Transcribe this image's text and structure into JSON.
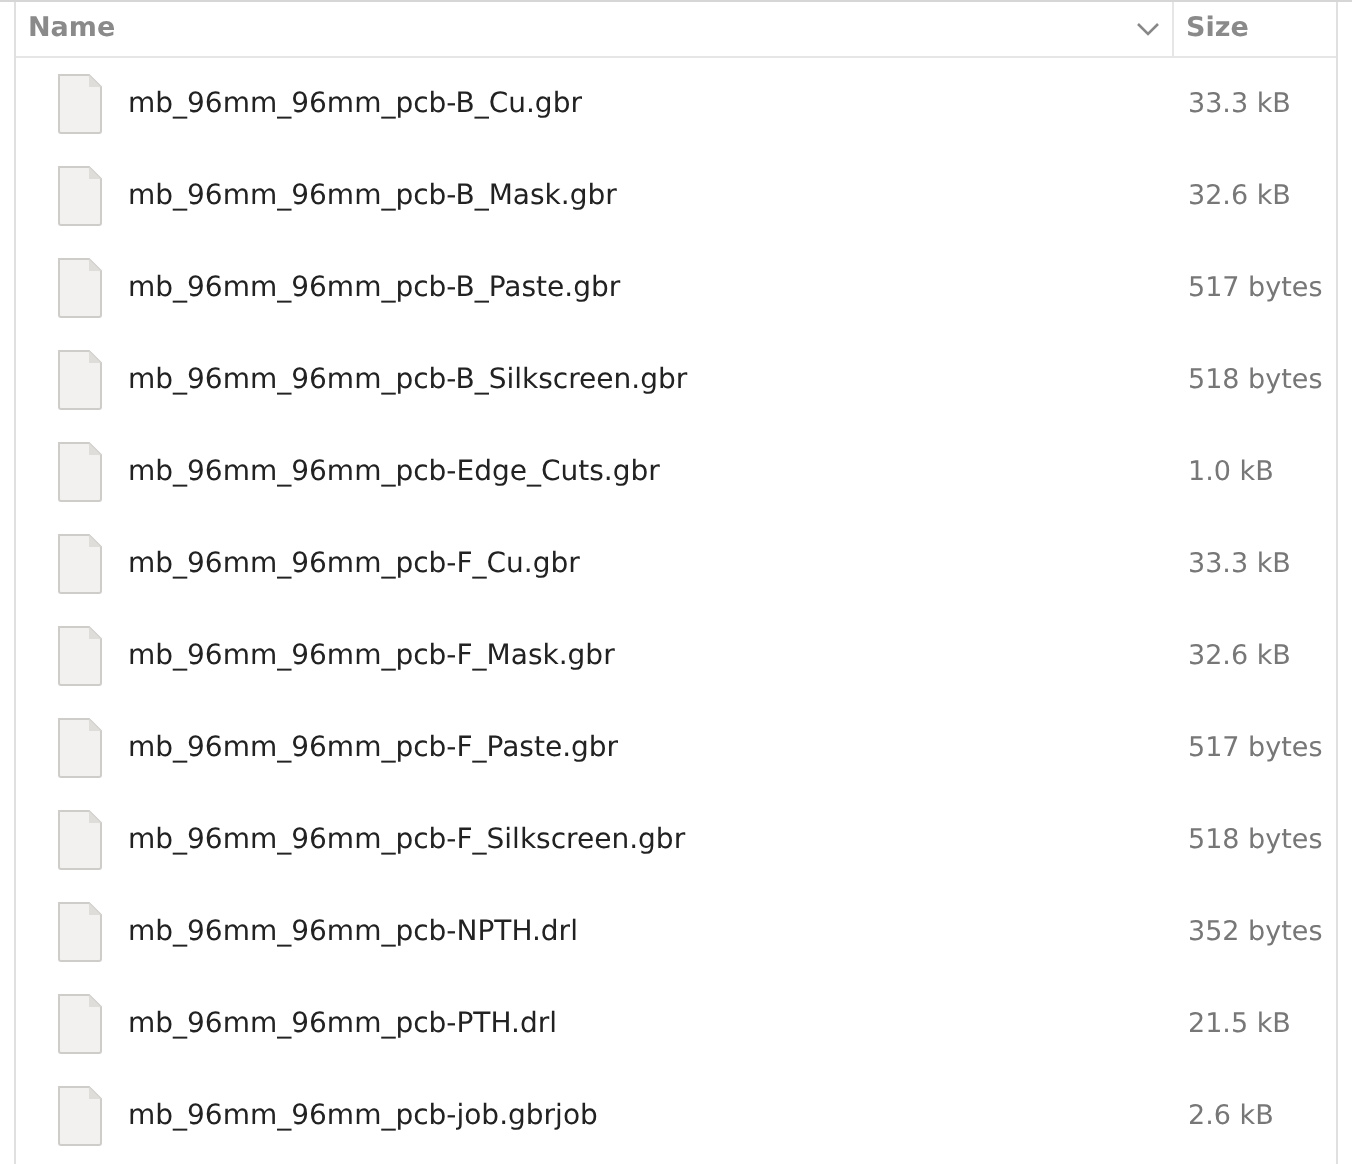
{
  "columns": [
    {
      "label": "Name",
      "sorted": true
    },
    {
      "label": "Size",
      "sorted": false
    }
  ],
  "files": [
    {
      "name": "mb_96mm_96mm_pcb-B_Cu.gbr",
      "size": "33.3 kB"
    },
    {
      "name": "mb_96mm_96mm_pcb-B_Mask.gbr",
      "size": "32.6 kB"
    },
    {
      "name": "mb_96mm_96mm_pcb-B_Paste.gbr",
      "size": "517 bytes"
    },
    {
      "name": "mb_96mm_96mm_pcb-B_Silkscreen.gbr",
      "size": "518 bytes"
    },
    {
      "name": "mb_96mm_96mm_pcb-Edge_Cuts.gbr",
      "size": "1.0 kB"
    },
    {
      "name": "mb_96mm_96mm_pcb-F_Cu.gbr",
      "size": "33.3 kB"
    },
    {
      "name": "mb_96mm_96mm_pcb-F_Mask.gbr",
      "size": "32.6 kB"
    },
    {
      "name": "mb_96mm_96mm_pcb-F_Paste.gbr",
      "size": "517 bytes"
    },
    {
      "name": "mb_96mm_96mm_pcb-F_Silkscreen.gbr",
      "size": "518 bytes"
    },
    {
      "name": "mb_96mm_96mm_pcb-NPTH.drl",
      "size": "352 bytes"
    },
    {
      "name": "mb_96mm_96mm_pcb-PTH.drl",
      "size": "21.5 kB"
    },
    {
      "name": "mb_96mm_96mm_pcb-job.gbrjob",
      "size": "2.6 kB"
    }
  ]
}
